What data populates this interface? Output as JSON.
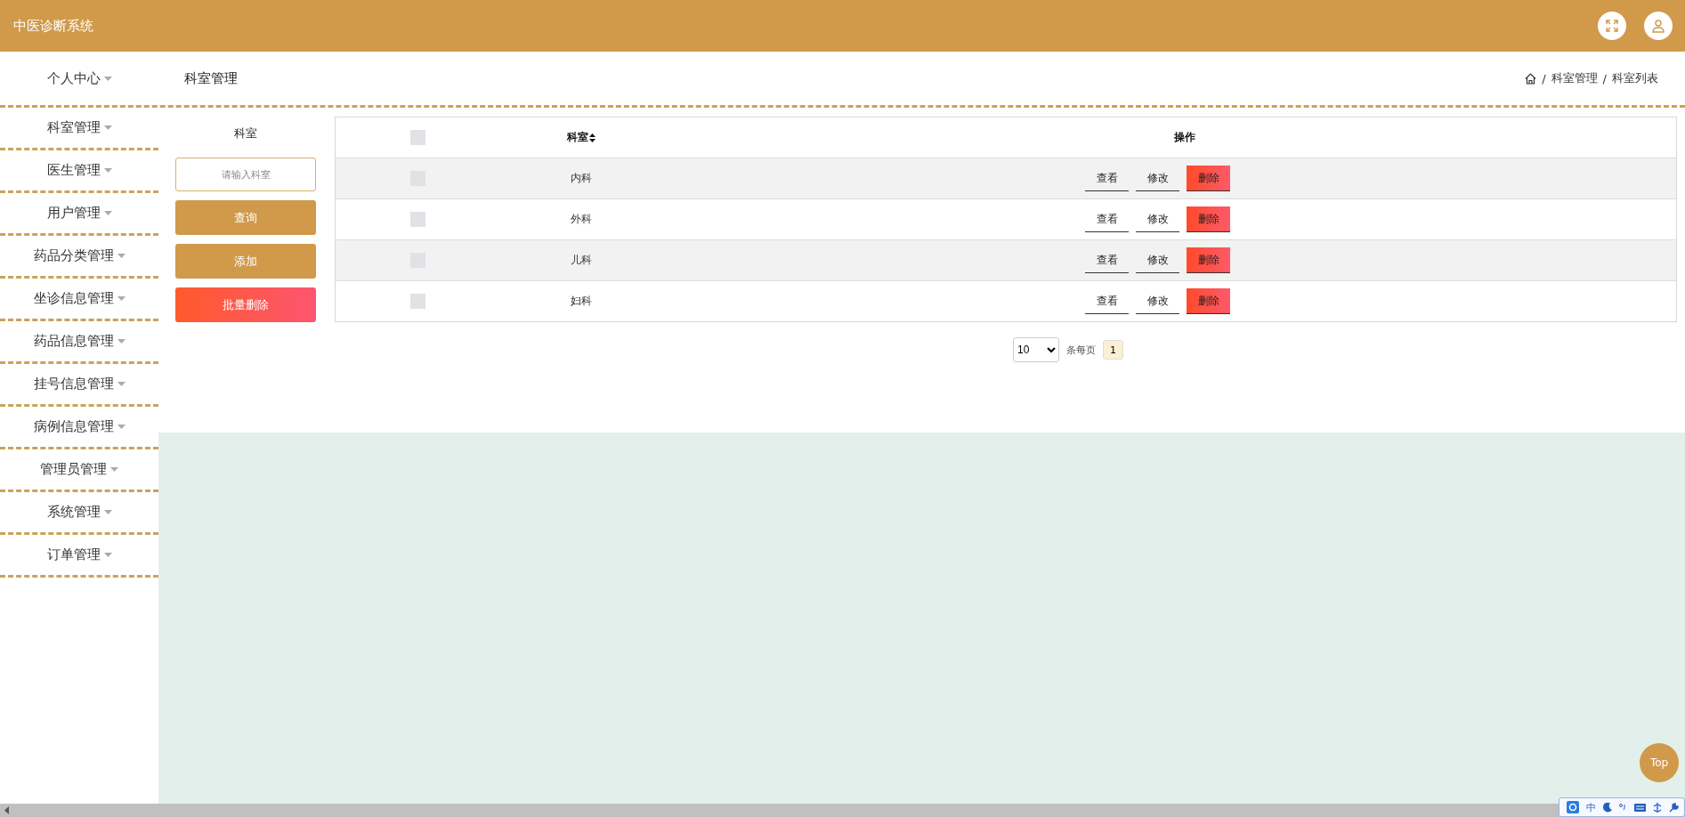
{
  "header": {
    "title": "中医诊断系统"
  },
  "sidebar": {
    "items": [
      {
        "label": "个人中心"
      },
      {
        "label": "科室管理"
      },
      {
        "label": "医生管理"
      },
      {
        "label": "用户管理"
      },
      {
        "label": "药品分类管理"
      },
      {
        "label": "坐诊信息管理"
      },
      {
        "label": "药品信息管理"
      },
      {
        "label": "挂号信息管理"
      },
      {
        "label": "病例信息管理"
      },
      {
        "label": "管理员管理"
      },
      {
        "label": "系统管理"
      },
      {
        "label": "订单管理"
      }
    ]
  },
  "page_title": "科室管理",
  "breadcrumb": [
    {
      "separator": "/",
      "label": "科室管理"
    },
    {
      "separator": "/",
      "label": "科室列表"
    }
  ],
  "search": {
    "label": "科室",
    "placeholder": "请输入科室"
  },
  "actions": [
    {
      "label": "查询",
      "kind": "primary"
    },
    {
      "label": "添加",
      "kind": "primary"
    },
    {
      "label": "批量删除",
      "kind": "danger"
    }
  ],
  "table": {
    "header_checked": false,
    "columns": [
      "科室",
      "操作"
    ],
    "rows": [
      {
        "checked": false,
        "name": "内科",
        "buttons": [
          "查看",
          "修改",
          "删除"
        ]
      },
      {
        "checked": false,
        "name": "外科",
        "buttons": [
          "查看",
          "修改",
          "删除"
        ]
      },
      {
        "checked": false,
        "name": "儿科",
        "buttons": [
          "查看",
          "修改",
          "删除"
        ]
      },
      {
        "checked": false,
        "name": "妇科",
        "buttons": [
          "查看",
          "修改",
          "删除"
        ]
      }
    ]
  },
  "pagination": {
    "page_size": "10",
    "per_page_label": "条每页",
    "pages": [
      {
        "label": "1",
        "selected": true
      }
    ]
  },
  "top_button": "Top",
  "ime_toolbar": {
    "label": "中"
  }
}
